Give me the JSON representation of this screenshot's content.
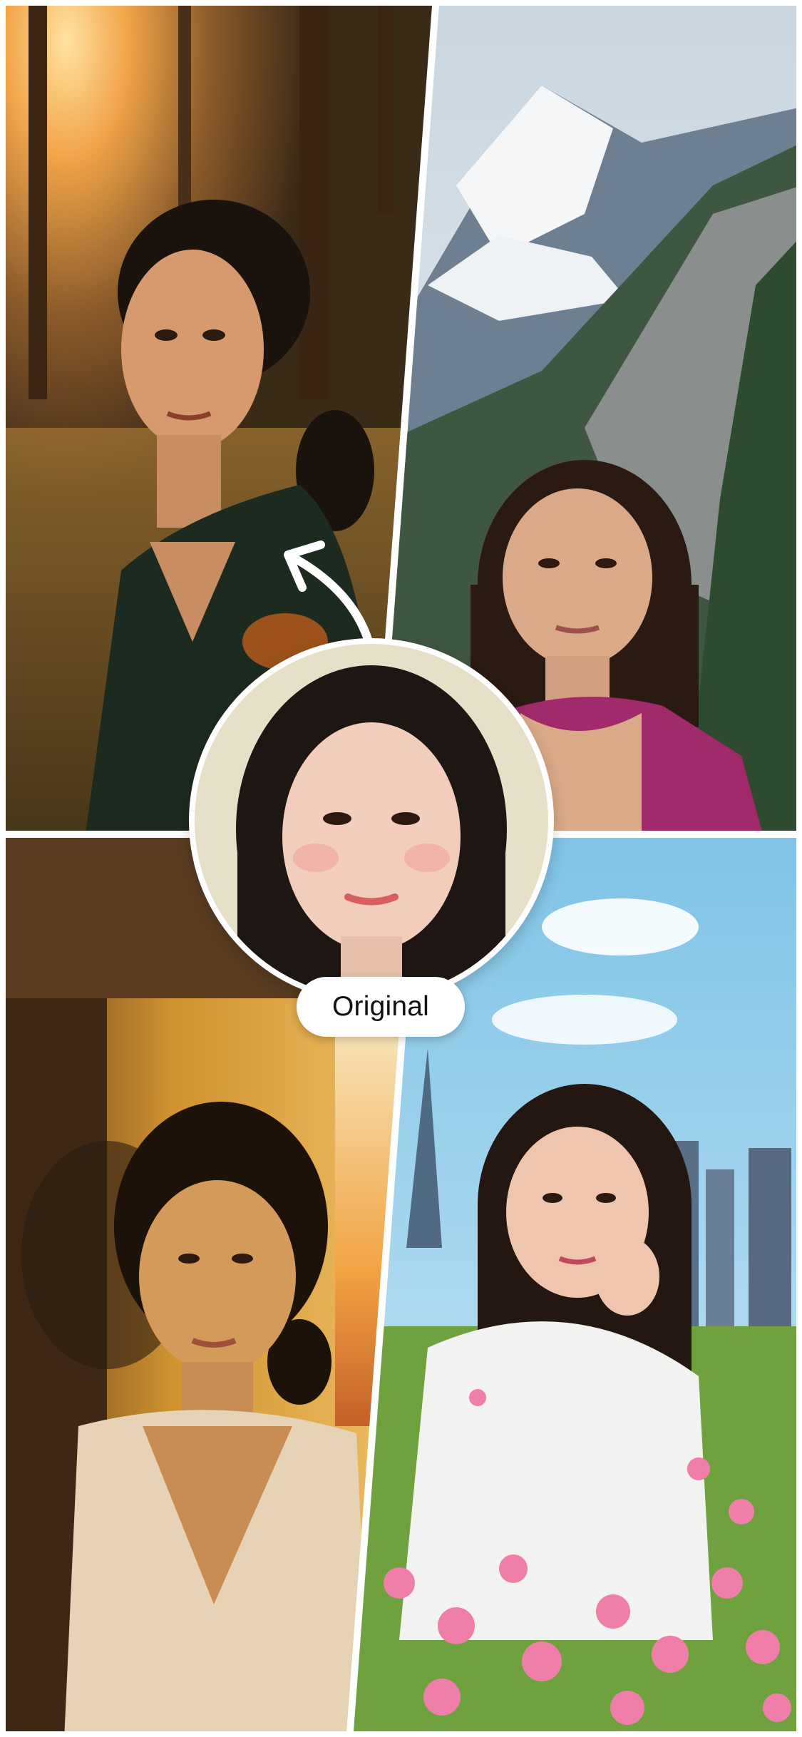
{
  "badge": {
    "label": "Original"
  },
  "icons": {
    "arrow": "curved-arrow-icon"
  },
  "colors": {
    "badge_background": "#ffffff",
    "badge_text": "#111111",
    "divider": "#ffffff"
  }
}
